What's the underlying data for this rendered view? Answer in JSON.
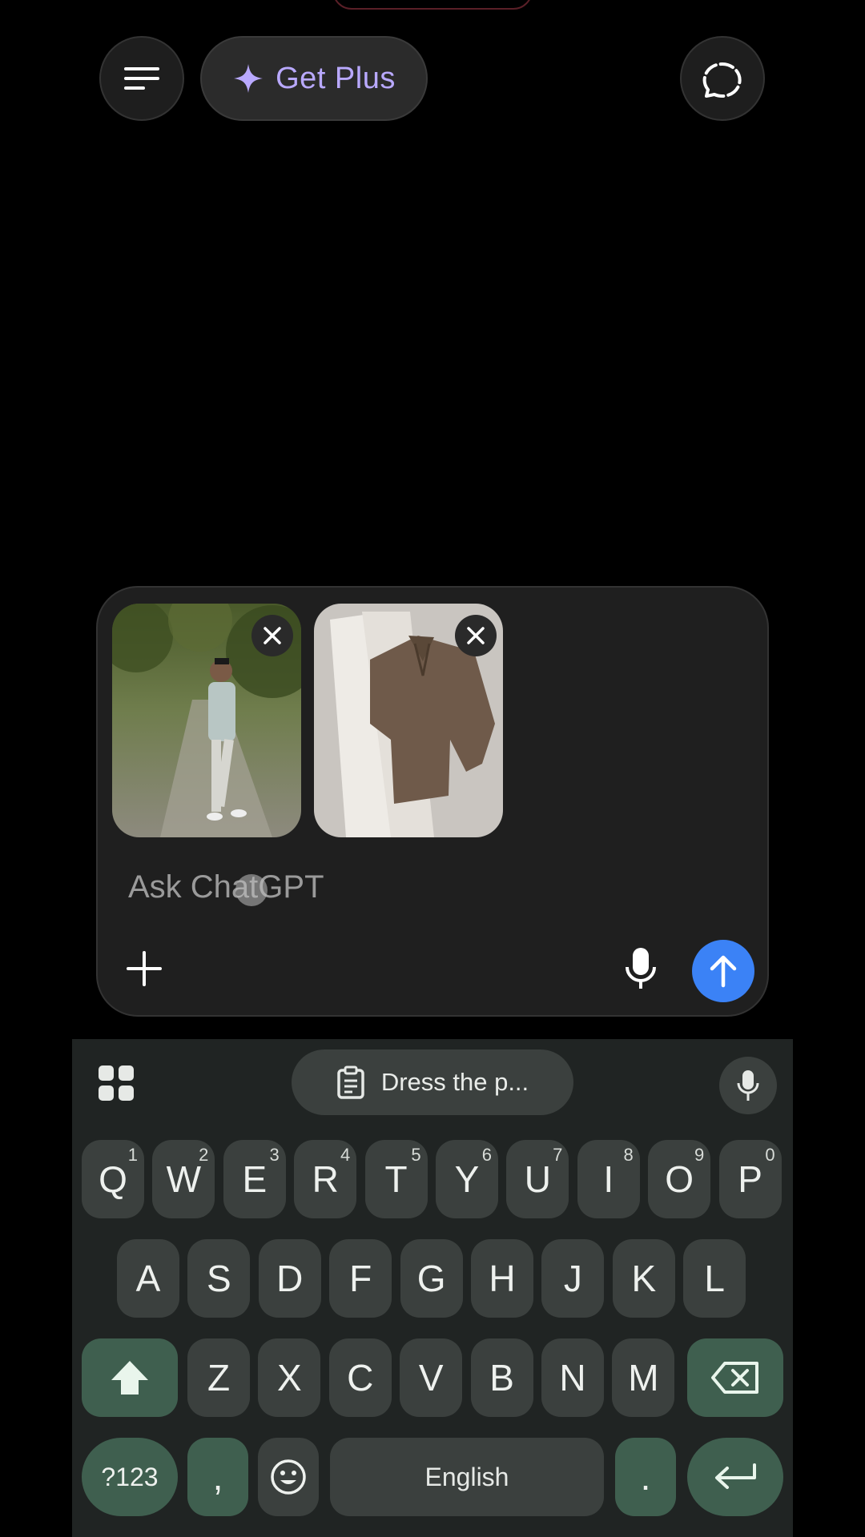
{
  "header": {
    "get_plus_label": "Get Plus"
  },
  "composer": {
    "placeholder": "Ask ChatGPT",
    "attachments": [
      {
        "name": "person-photo"
      },
      {
        "name": "outfit-photo"
      }
    ]
  },
  "keyboard": {
    "clipboard_suggestion": "Dress the p...",
    "row1": [
      {
        "k": "Q",
        "n": "1"
      },
      {
        "k": "W",
        "n": "2"
      },
      {
        "k": "E",
        "n": "3"
      },
      {
        "k": "R",
        "n": "4"
      },
      {
        "k": "T",
        "n": "5"
      },
      {
        "k": "Y",
        "n": "6"
      },
      {
        "k": "U",
        "n": "7"
      },
      {
        "k": "I",
        "n": "8"
      },
      {
        "k": "O",
        "n": "9"
      },
      {
        "k": "P",
        "n": "0"
      }
    ],
    "row2": [
      "A",
      "S",
      "D",
      "F",
      "G",
      "H",
      "J",
      "K",
      "L"
    ],
    "row3": [
      "Z",
      "X",
      "C",
      "V",
      "B",
      "N",
      "M"
    ],
    "symbols_label": "?123",
    "comma": ",",
    "space_label": "English",
    "period": "."
  },
  "colors": {
    "accent_purple": "#b9a9ff",
    "send_blue": "#3b82f6",
    "key_accent": "#3f5f4f"
  }
}
